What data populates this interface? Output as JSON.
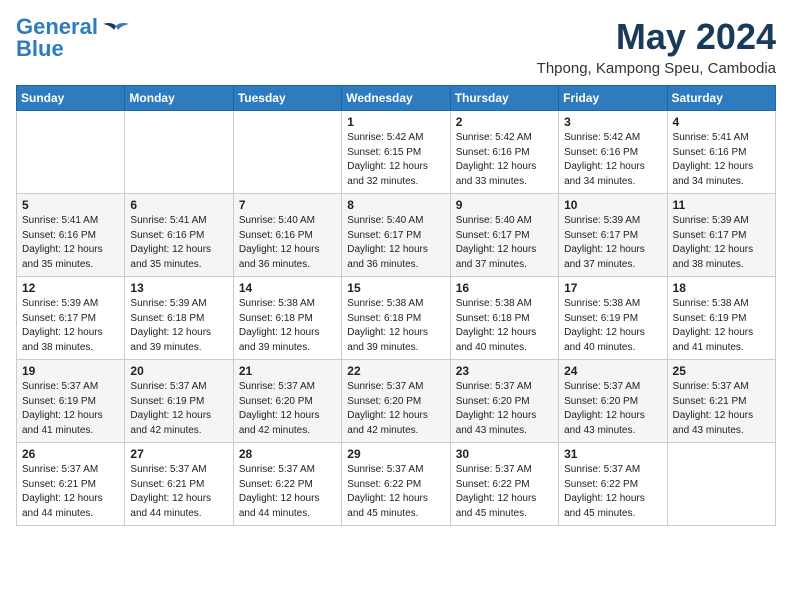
{
  "logo": {
    "line1": "General",
    "line2": "Blue"
  },
  "title": {
    "month_year": "May 2024",
    "location": "Thpong, Kampong Speu, Cambodia"
  },
  "days_of_week": [
    "Sunday",
    "Monday",
    "Tuesday",
    "Wednesday",
    "Thursday",
    "Friday",
    "Saturday"
  ],
  "weeks": [
    [
      {
        "day": "",
        "content": ""
      },
      {
        "day": "",
        "content": ""
      },
      {
        "day": "",
        "content": ""
      },
      {
        "day": "1",
        "sunrise": "5:42 AM",
        "sunset": "6:15 PM",
        "daylight": "12 hours and 32 minutes."
      },
      {
        "day": "2",
        "sunrise": "5:42 AM",
        "sunset": "6:16 PM",
        "daylight": "12 hours and 33 minutes."
      },
      {
        "day": "3",
        "sunrise": "5:42 AM",
        "sunset": "6:16 PM",
        "daylight": "12 hours and 34 minutes."
      },
      {
        "day": "4",
        "sunrise": "5:41 AM",
        "sunset": "6:16 PM",
        "daylight": "12 hours and 34 minutes."
      }
    ],
    [
      {
        "day": "5",
        "sunrise": "5:41 AM",
        "sunset": "6:16 PM",
        "daylight": "12 hours and 35 minutes."
      },
      {
        "day": "6",
        "sunrise": "5:41 AM",
        "sunset": "6:16 PM",
        "daylight": "12 hours and 35 minutes."
      },
      {
        "day": "7",
        "sunrise": "5:40 AM",
        "sunset": "6:16 PM",
        "daylight": "12 hours and 36 minutes."
      },
      {
        "day": "8",
        "sunrise": "5:40 AM",
        "sunset": "6:17 PM",
        "daylight": "12 hours and 36 minutes."
      },
      {
        "day": "9",
        "sunrise": "5:40 AM",
        "sunset": "6:17 PM",
        "daylight": "12 hours and 37 minutes."
      },
      {
        "day": "10",
        "sunrise": "5:39 AM",
        "sunset": "6:17 PM",
        "daylight": "12 hours and 37 minutes."
      },
      {
        "day": "11",
        "sunrise": "5:39 AM",
        "sunset": "6:17 PM",
        "daylight": "12 hours and 38 minutes."
      }
    ],
    [
      {
        "day": "12",
        "sunrise": "5:39 AM",
        "sunset": "6:17 PM",
        "daylight": "12 hours and 38 minutes."
      },
      {
        "day": "13",
        "sunrise": "5:39 AM",
        "sunset": "6:18 PM",
        "daylight": "12 hours and 39 minutes."
      },
      {
        "day": "14",
        "sunrise": "5:38 AM",
        "sunset": "6:18 PM",
        "daylight": "12 hours and 39 minutes."
      },
      {
        "day": "15",
        "sunrise": "5:38 AM",
        "sunset": "6:18 PM",
        "daylight": "12 hours and 39 minutes."
      },
      {
        "day": "16",
        "sunrise": "5:38 AM",
        "sunset": "6:18 PM",
        "daylight": "12 hours and 40 minutes."
      },
      {
        "day": "17",
        "sunrise": "5:38 AM",
        "sunset": "6:19 PM",
        "daylight": "12 hours and 40 minutes."
      },
      {
        "day": "18",
        "sunrise": "5:38 AM",
        "sunset": "6:19 PM",
        "daylight": "12 hours and 41 minutes."
      }
    ],
    [
      {
        "day": "19",
        "sunrise": "5:37 AM",
        "sunset": "6:19 PM",
        "daylight": "12 hours and 41 minutes."
      },
      {
        "day": "20",
        "sunrise": "5:37 AM",
        "sunset": "6:19 PM",
        "daylight": "12 hours and 42 minutes."
      },
      {
        "day": "21",
        "sunrise": "5:37 AM",
        "sunset": "6:20 PM",
        "daylight": "12 hours and 42 minutes."
      },
      {
        "day": "22",
        "sunrise": "5:37 AM",
        "sunset": "6:20 PM",
        "daylight": "12 hours and 42 minutes."
      },
      {
        "day": "23",
        "sunrise": "5:37 AM",
        "sunset": "6:20 PM",
        "daylight": "12 hours and 43 minutes."
      },
      {
        "day": "24",
        "sunrise": "5:37 AM",
        "sunset": "6:20 PM",
        "daylight": "12 hours and 43 minutes."
      },
      {
        "day": "25",
        "sunrise": "5:37 AM",
        "sunset": "6:21 PM",
        "daylight": "12 hours and 43 minutes."
      }
    ],
    [
      {
        "day": "26",
        "sunrise": "5:37 AM",
        "sunset": "6:21 PM",
        "daylight": "12 hours and 44 minutes."
      },
      {
        "day": "27",
        "sunrise": "5:37 AM",
        "sunset": "6:21 PM",
        "daylight": "12 hours and 44 minutes."
      },
      {
        "day": "28",
        "sunrise": "5:37 AM",
        "sunset": "6:22 PM",
        "daylight": "12 hours and 44 minutes."
      },
      {
        "day": "29",
        "sunrise": "5:37 AM",
        "sunset": "6:22 PM",
        "daylight": "12 hours and 45 minutes."
      },
      {
        "day": "30",
        "sunrise": "5:37 AM",
        "sunset": "6:22 PM",
        "daylight": "12 hours and 45 minutes."
      },
      {
        "day": "31",
        "sunrise": "5:37 AM",
        "sunset": "6:22 PM",
        "daylight": "12 hours and 45 minutes."
      },
      {
        "day": "",
        "content": ""
      }
    ]
  ],
  "labels": {
    "sunrise_prefix": "Sunrise: ",
    "sunset_prefix": "Sunset: ",
    "daylight_label": "Daylight: "
  }
}
